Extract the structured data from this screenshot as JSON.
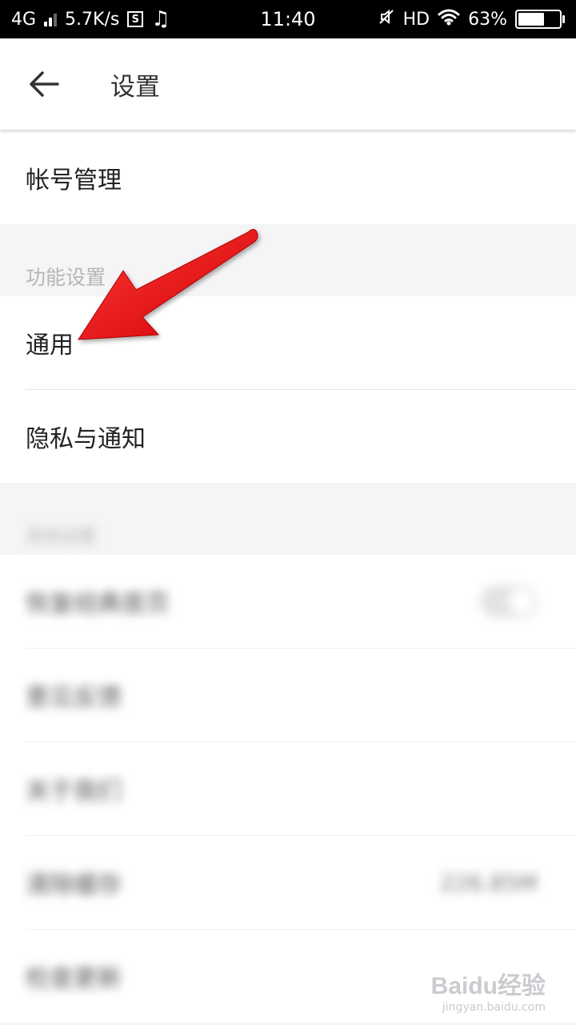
{
  "status_bar": {
    "network": "4G",
    "speed": "5.7K/s",
    "s_badge": "S",
    "time": "11:40",
    "hd": "HD",
    "battery_text": "63%",
    "battery_level": 0.63
  },
  "app_bar": {
    "title": "设置"
  },
  "account": {
    "label": "帐号管理"
  },
  "sections": {
    "function_header": "功能设置",
    "general_label": "通用",
    "privacy_label": "隐私与通知"
  },
  "blurred": {
    "header": "其他设置",
    "rows": [
      {
        "label": "恢复经典首页"
      },
      {
        "label": "意见反馈"
      },
      {
        "label": "关于我们"
      },
      {
        "label": "清除缓存",
        "value": "226.85M"
      },
      {
        "label": "检查更新"
      }
    ]
  },
  "watermark": {
    "main": "Baidu经验",
    "sub": "jingyan.baidu.com"
  },
  "colors": {
    "arrow": "#e60d0d",
    "section_bg": "#f5f5f7",
    "header_text": "#b5b5b8"
  }
}
